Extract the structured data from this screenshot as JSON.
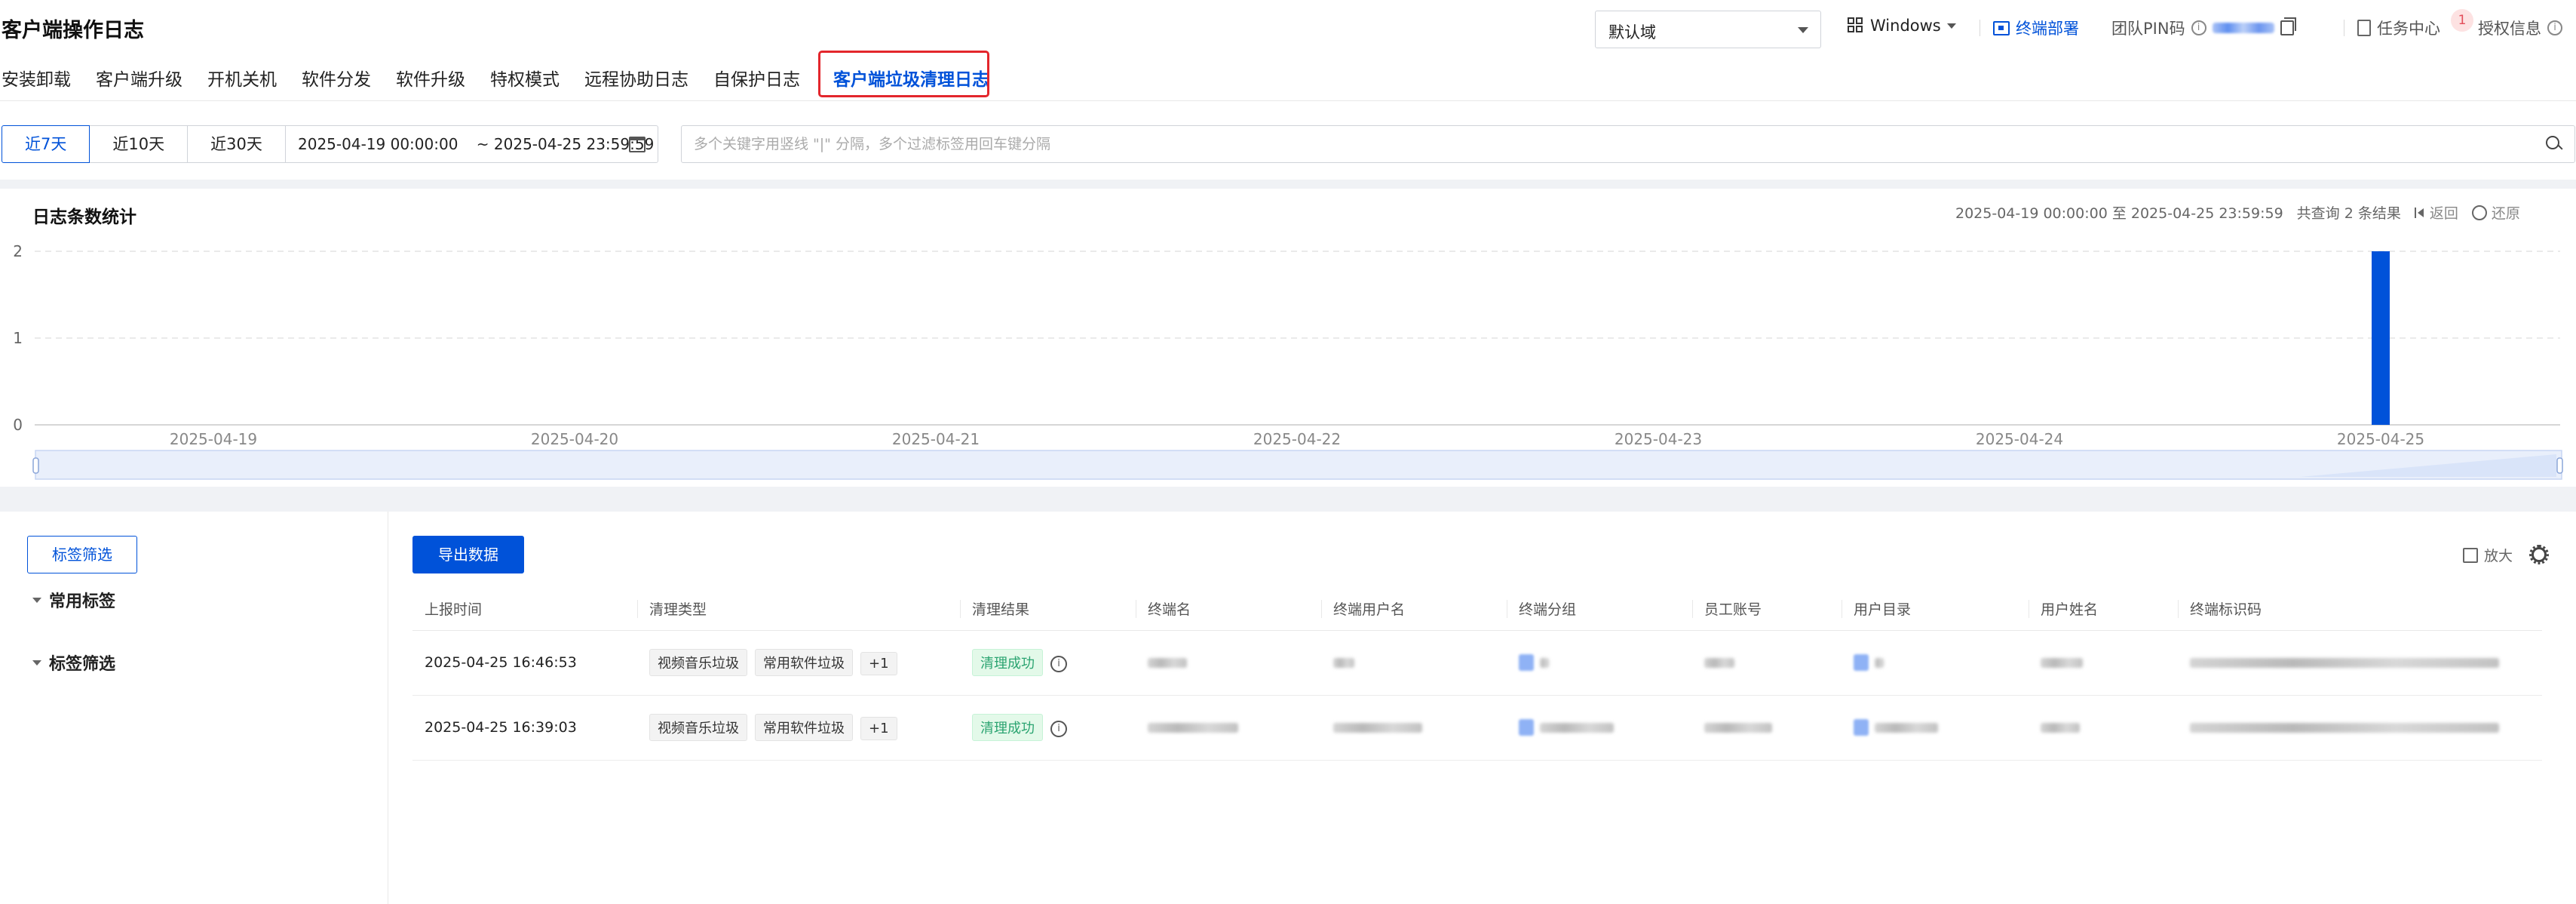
{
  "header": {
    "title": "客户端操作日志",
    "domain_select": "默认域",
    "os": "Windows",
    "deploy": "终端部署",
    "team_pin": "团队PIN码",
    "task_center": "任务中心",
    "task_badge": "1",
    "license": "授权信息"
  },
  "tabs": [
    {
      "label": "安装卸载"
    },
    {
      "label": "客户端升级"
    },
    {
      "label": "开机关机"
    },
    {
      "label": "软件分发"
    },
    {
      "label": "软件升级"
    },
    {
      "label": "特权模式"
    },
    {
      "label": "远程协助日志"
    },
    {
      "label": "自保护日志"
    },
    {
      "label": "客户端垃圾清理日志"
    }
  ],
  "filter": {
    "ranges": [
      "近7天",
      "近10天",
      "近30天"
    ],
    "date_start": "2025-04-19 00:00:00",
    "date_end": "~ 2025-04-25 23:59:59",
    "search_placeholder": "多个关键字用竖线 \"|\" 分隔，多个过滤标签用回车键分隔"
  },
  "chart_panel": {
    "title": "日志条数统计",
    "range_text": "2025-04-19 00:00:00 至 2025-04-25 23:59:59",
    "result_text": "共查询 2 条结果",
    "back": "返回",
    "restore": "还原"
  },
  "chart_data": {
    "type": "bar",
    "categories": [
      "2025-04-19",
      "2025-04-20",
      "2025-04-21",
      "2025-04-22",
      "2025-04-23",
      "2025-04-24",
      "2025-04-25"
    ],
    "values": [
      0,
      0,
      0,
      0,
      0,
      0,
      2
    ],
    "ylim": [
      0,
      2
    ],
    "yticks": [
      "0",
      "1",
      "2"
    ],
    "bar_color": "#0052d9",
    "grid": true
  },
  "lower": {
    "tag_filter_btn": "标签筛选",
    "tree": [
      "常用标签",
      "标签筛选"
    ],
    "export": "导出数据",
    "zoom": "放大"
  },
  "table": {
    "columns": [
      "上报时间",
      "清理类型",
      "清理结果",
      "终端名",
      "终端用户名",
      "终端分组",
      "员工账号",
      "用户目录",
      "用户姓名",
      "终端标识码"
    ],
    "rows": [
      {
        "time": "2025-04-25 16:46:53",
        "tags": [
          "视频音乐垃圾",
          "常用软件垃圾",
          "+1"
        ],
        "result": "清理成功"
      },
      {
        "time": "2025-04-25 16:39:03",
        "tags": [
          "视频音乐垃圾",
          "常用软件垃圾",
          "+1"
        ],
        "result": "清理成功"
      }
    ]
  }
}
